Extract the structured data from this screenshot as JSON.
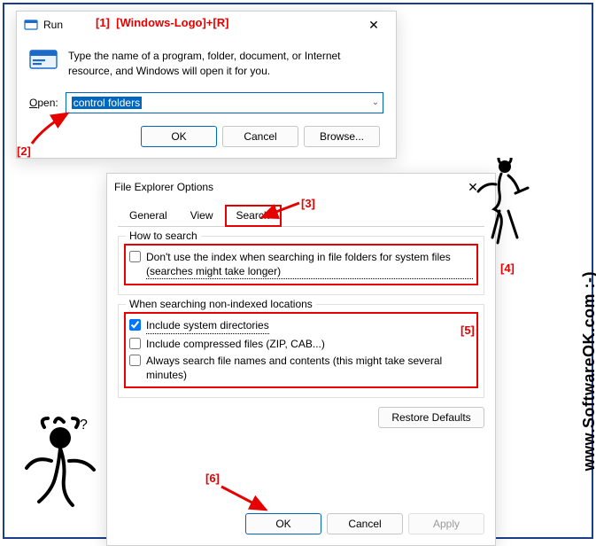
{
  "annotations": {
    "a1": "[1]",
    "a1_text": "[Windows-Logo]+[R]",
    "a2": "[2]",
    "a3": "[3]",
    "a4": "[4]",
    "a5": "[5]",
    "a6": "[6]"
  },
  "watermark": "www.SoftwareOK.com :-)",
  "run": {
    "title": "Run",
    "desc": "Type the name of a program, folder, document, or Internet resource, and Windows will open it for you.",
    "open_char": "O",
    "open_rest": "pen:",
    "value": "control folders",
    "ok": "OK",
    "cancel": "Cancel",
    "browse": "Browse..."
  },
  "feo": {
    "title": "File Explorer Options",
    "tabs": {
      "general": "General",
      "view": "View",
      "search": "Search"
    },
    "group1_title": "How to search",
    "opt1": "Don't use the index when searching in file folders for system files (searches might take longer)",
    "group2_title": "When searching non-indexed locations",
    "opt2": "Include system directories",
    "opt3": "Include compressed files (ZIP, CAB...)",
    "opt4": "Always search file names and contents (this might take several minutes)",
    "restore": "Restore Defaults",
    "ok": "OK",
    "cancel": "Cancel",
    "apply": "Apply"
  }
}
